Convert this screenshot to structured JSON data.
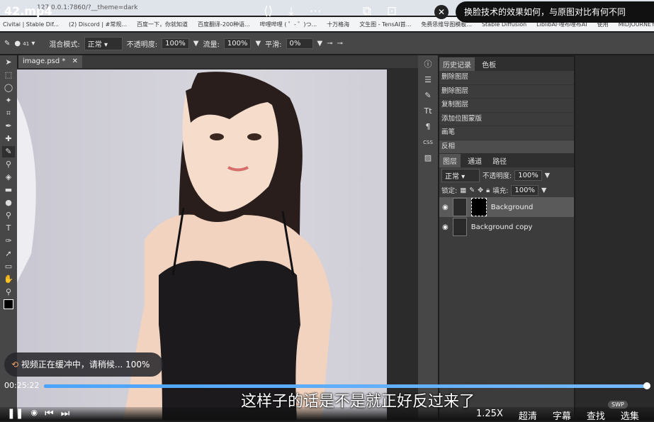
{
  "browser": {
    "address": "127.0.0.1:7860/?__theme=dark",
    "bookmarks": [
      "Civitai | Stable Dif...",
      "(2) Discord | #常规...",
      "百度一下，你就知道",
      "百度翻译-200种语...",
      "哔哩哔哩 ( ゜- ゜)つ...",
      "十万格海",
      "文生图 - TensAI首...",
      "免费思维导图模板...",
      "Stable Diffusion",
      "LiblibAI·哩布哩布AI",
      "使用",
      "MIDJOURNEY模型..."
    ]
  },
  "photoshop": {
    "options": {
      "mode_label": "混合模式:",
      "mode_value": "正常",
      "opacity_label": "不透明度:",
      "opacity_value": "100%",
      "flow_label": "流量:",
      "flow_value": "100%",
      "smooth_label": "平滑:",
      "smooth_value": "0%",
      "brush_size": "41"
    },
    "doc_tab": "image.psd *",
    "history": {
      "tabs": [
        "历史记录",
        "色板"
      ],
      "items": [
        "删除图层",
        "删除图层",
        "复制图层",
        "添加位图蒙版",
        "画笔",
        "反相"
      ]
    },
    "layers": {
      "tabs": [
        "图层",
        "通道",
        "路径"
      ],
      "blend": "正常",
      "opacity_label": "不透明度:",
      "opacity": "100%",
      "lock_label": "锁定:",
      "fill_label": "填充:",
      "fill": "100%",
      "items": [
        "Background",
        "Background copy"
      ]
    }
  },
  "player": {
    "title": "42.mp4",
    "video_title": "换脸技术的效果如何，与原图对比有何不同",
    "buffer_text": "视频正在缓冲中，请稍候... 100%",
    "current_time": "00:25:22",
    "progress": 0.995,
    "subtitle": "这样子的话是不是就正好反过来了",
    "speed": "1.25X",
    "quality": "超清",
    "captions": "字幕",
    "search": "查找",
    "select": "选集",
    "swp": "SWP"
  }
}
